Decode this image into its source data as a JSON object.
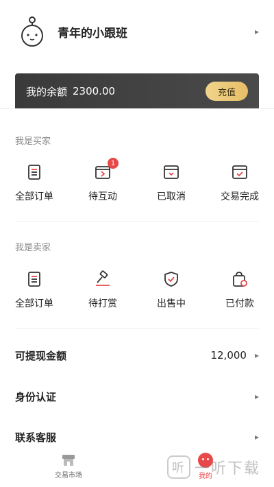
{
  "profile": {
    "name": "青年的小跟班"
  },
  "balance": {
    "label": "我的余额",
    "amount": "2300.00",
    "recharge": "充值"
  },
  "buyer": {
    "title": "我是买家",
    "items": [
      {
        "label": "全部订单",
        "icon": "order-list-icon"
      },
      {
        "label": "待互动",
        "icon": "pending-interaction-icon",
        "badge": "1"
      },
      {
        "label": "已取消",
        "icon": "cancelled-box-icon"
      },
      {
        "label": "交易完成",
        "icon": "completed-box-icon"
      }
    ]
  },
  "seller": {
    "title": "我是卖家",
    "items": [
      {
        "label": "全部订单",
        "icon": "order-list-icon"
      },
      {
        "label": "待打赏",
        "icon": "auction-hammer-icon"
      },
      {
        "label": "出售中",
        "icon": "shield-check-icon"
      },
      {
        "label": "已付款",
        "icon": "paid-bag-icon"
      }
    ]
  },
  "rows": {
    "withdraw": {
      "label": "可提现金额",
      "value": "12,000"
    },
    "identity": {
      "label": "身份认证"
    },
    "support": {
      "label": "联系客服"
    }
  },
  "tabbar": {
    "market": "交易市场",
    "me": "我的"
  },
  "watermark": {
    "text": "一听下载",
    "logo": "听"
  },
  "colors": {
    "accent": "#e84848",
    "gold": "#e6be67",
    "card": "#3f3f3f"
  }
}
